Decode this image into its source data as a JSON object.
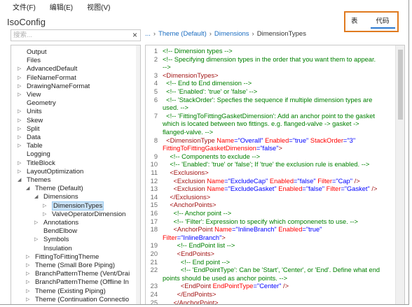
{
  "menu": [
    "文件(F)",
    "编辑(E)",
    "视图(V)"
  ],
  "app_title": "IsoConfig",
  "search": {
    "placeholder": "搜索..."
  },
  "breadcrumb": [
    "...",
    "Theme (Default)",
    "Dimensions",
    "DimensionTypes"
  ],
  "view_toggle": [
    "表",
    "代码"
  ],
  "colors": {
    "accent_border": "#e07a1f",
    "link": "#1a6cc0",
    "comment": "#008000",
    "tag": "#a31515",
    "attr": "#ff0000",
    "value": "#0000ff"
  },
  "tree": [
    {
      "label": "Output",
      "indent": 0,
      "caret": ""
    },
    {
      "label": "Files",
      "indent": 0,
      "caret": ""
    },
    {
      "label": "AdvancedDefault",
      "indent": 0,
      "caret": "▷"
    },
    {
      "label": "FileNameFormat",
      "indent": 0,
      "caret": "▷"
    },
    {
      "label": "DrawingNameFormat",
      "indent": 0,
      "caret": "▷"
    },
    {
      "label": "View",
      "indent": 0,
      "caret": "▷"
    },
    {
      "label": "Geometry",
      "indent": 0,
      "caret": ""
    },
    {
      "label": "Units",
      "indent": 0,
      "caret": "▷"
    },
    {
      "label": "Skew",
      "indent": 0,
      "caret": "▷"
    },
    {
      "label": "Split",
      "indent": 0,
      "caret": "▷"
    },
    {
      "label": "Data",
      "indent": 0,
      "caret": "▷"
    },
    {
      "label": "Table",
      "indent": 0,
      "caret": "▷"
    },
    {
      "label": "Logging",
      "indent": 0,
      "caret": ""
    },
    {
      "label": "TitleBlock",
      "indent": 0,
      "caret": "▷"
    },
    {
      "label": "LayoutOptimization",
      "indent": 0,
      "caret": "▷"
    },
    {
      "label": "Themes",
      "indent": 0,
      "caret": "◢"
    },
    {
      "label": "Theme (Default)",
      "indent": 1,
      "caret": "◢"
    },
    {
      "label": "Dimensions",
      "indent": 2,
      "caret": "◢"
    },
    {
      "label": "DimensionTypes",
      "indent": 3,
      "caret": "▷",
      "selected": true
    },
    {
      "label": "ValveOperatorDimension",
      "indent": 3,
      "caret": "▷"
    },
    {
      "label": "Annotations",
      "indent": 2,
      "caret": "▷"
    },
    {
      "label": "BendElbow",
      "indent": 2,
      "caret": ""
    },
    {
      "label": "Symbols",
      "indent": 2,
      "caret": "▷"
    },
    {
      "label": "Insulation",
      "indent": 2,
      "caret": ""
    },
    {
      "label": "FittingToFittingTheme",
      "indent": 1,
      "caret": "▷"
    },
    {
      "label": "Theme (Small Bore Piping)",
      "indent": 1,
      "caret": "▷"
    },
    {
      "label": "BranchPatternTheme (Vent/Drai",
      "indent": 1,
      "caret": "▷"
    },
    {
      "label": "BranchPatternTheme (Offline In",
      "indent": 1,
      "caret": "▷"
    },
    {
      "label": "Theme (Existing Piping)",
      "indent": 1,
      "caret": "▷"
    },
    {
      "label": "Theme (Continuation Connectio",
      "indent": 1,
      "caret": "▷"
    }
  ],
  "code_lines": [
    {
      "n": "1",
      "segs": [
        [
          "c",
          "<!-- Dimension types -->"
        ]
      ]
    },
    {
      "n": "2",
      "segs": [
        [
          "c",
          "<!-- Specifying dimension types in the order that you want them to appear."
        ]
      ]
    },
    {
      "n": "",
      "segs": [
        [
          "c",
          "-->"
        ]
      ]
    },
    {
      "n": "3",
      "segs": [
        [
          "t",
          "<DimensionTypes>"
        ]
      ]
    },
    {
      "n": "4",
      "segs": [
        [
          "c",
          "  <!-- End to End dimension -->"
        ]
      ]
    },
    {
      "n": "5",
      "segs": [
        [
          "c",
          "  <!-- 'Enabled': 'true' or 'false' -->"
        ]
      ]
    },
    {
      "n": "6",
      "segs": [
        [
          "c",
          "  <!-- 'StackOrder': Specfies the sequence if multiple dimension types are"
        ]
      ]
    },
    {
      "n": "",
      "segs": [
        [
          "c",
          "used. -->"
        ]
      ]
    },
    {
      "n": "7",
      "segs": [
        [
          "c",
          "  <!-- 'FittingToFittingGasketDimension': Add an anchor point to the gasket"
        ]
      ]
    },
    {
      "n": "",
      "segs": [
        [
          "c",
          "which is located between two fittings. e.g. flanged-valve -> gasket ->"
        ]
      ]
    },
    {
      "n": "",
      "segs": [
        [
          "c",
          "flanged-valve. -->"
        ]
      ]
    },
    {
      "n": "8",
      "segs": [
        [
          "t",
          "  <DimensionType "
        ],
        [
          "a",
          "Name"
        ],
        [
          "p",
          "=\"Overall\" "
        ],
        [
          "a",
          "Enabled"
        ],
        [
          "p",
          "=\"true\" "
        ],
        [
          "a",
          "StackOrder"
        ],
        [
          "p",
          "=\"3\""
        ]
      ]
    },
    {
      "n": "",
      "segs": [
        [
          "a",
          "FittingToFittingGasketDimension"
        ],
        [
          "p",
          "=\"false\""
        ],
        [
          "t",
          ">"
        ]
      ]
    },
    {
      "n": "9",
      "segs": [
        [
          "c",
          "    <!-- Components to exclude -->"
        ]
      ]
    },
    {
      "n": "10",
      "segs": [
        [
          "c",
          "    <!-- 'Enabled': 'true' or 'false'; If 'true' the exclusion rule is enabled. -->"
        ]
      ]
    },
    {
      "n": "11",
      "segs": [
        [
          "t",
          "    <Exclusions>"
        ]
      ]
    },
    {
      "n": "12",
      "segs": [
        [
          "t",
          "      <Exclusion "
        ],
        [
          "a",
          "Name"
        ],
        [
          "p",
          "=\"ExcludeCap\" "
        ],
        [
          "a",
          "Enabled"
        ],
        [
          "p",
          "=\"false\" "
        ],
        [
          "a",
          "Filter"
        ],
        [
          "p",
          "=\"Cap\" "
        ],
        [
          "t",
          "/>"
        ]
      ]
    },
    {
      "n": "13",
      "segs": [
        [
          "t",
          "      <Exclusion "
        ],
        [
          "a",
          "Name"
        ],
        [
          "p",
          "=\"ExcludeGasket\" "
        ],
        [
          "a",
          "Enabled"
        ],
        [
          "p",
          "=\"false\" "
        ],
        [
          "a",
          "Filter"
        ],
        [
          "p",
          "=\"Gasket\" "
        ],
        [
          "t",
          "/>"
        ]
      ]
    },
    {
      "n": "14",
      "segs": [
        [
          "t",
          "    </Exclusions>"
        ]
      ]
    },
    {
      "n": "15",
      "segs": [
        [
          "t",
          "    <AnchorPoints>"
        ]
      ]
    },
    {
      "n": "16",
      "segs": [
        [
          "c",
          "      <!-- Anchor point -->"
        ]
      ]
    },
    {
      "n": "17",
      "segs": [
        [
          "c",
          "      <!-- 'Filter': Expression to specify which componenets to use. -->"
        ]
      ]
    },
    {
      "n": "18",
      "segs": [
        [
          "t",
          "      <AnchorPoint "
        ],
        [
          "a",
          "Name"
        ],
        [
          "p",
          "=\"InlineBranch\" "
        ],
        [
          "a",
          "Enabled"
        ],
        [
          "p",
          "=\"true\""
        ]
      ]
    },
    {
      "n": "",
      "segs": [
        [
          "a",
          "Filter"
        ],
        [
          "p",
          "=\"InlineBranch\""
        ],
        [
          "t",
          ">"
        ]
      ]
    },
    {
      "n": "19",
      "segs": [
        [
          "c",
          "        <!-- EndPoint list -->"
        ]
      ]
    },
    {
      "n": "20",
      "segs": [
        [
          "t",
          "        <EndPoints>"
        ]
      ]
    },
    {
      "n": "21",
      "segs": [
        [
          "c",
          "          <!-- End point -->"
        ]
      ]
    },
    {
      "n": "22",
      "segs": [
        [
          "c",
          "          <!-- 'EndPointType': Can be 'Start', 'Center', or 'End'. Define what end"
        ]
      ]
    },
    {
      "n": "",
      "segs": [
        [
          "c",
          "points should be used as anchor points. -->"
        ]
      ]
    },
    {
      "n": "23",
      "segs": [
        [
          "t",
          "          <EndPoint "
        ],
        [
          "a",
          "EndPointType"
        ],
        [
          "p",
          "=\"Center\" "
        ],
        [
          "t",
          "/>"
        ]
      ]
    },
    {
      "n": "24",
      "segs": [
        [
          "t",
          "        </EndPoints>"
        ]
      ]
    },
    {
      "n": "25",
      "segs": [
        [
          "t",
          "      </AnchorPoint>"
        ]
      ]
    }
  ]
}
